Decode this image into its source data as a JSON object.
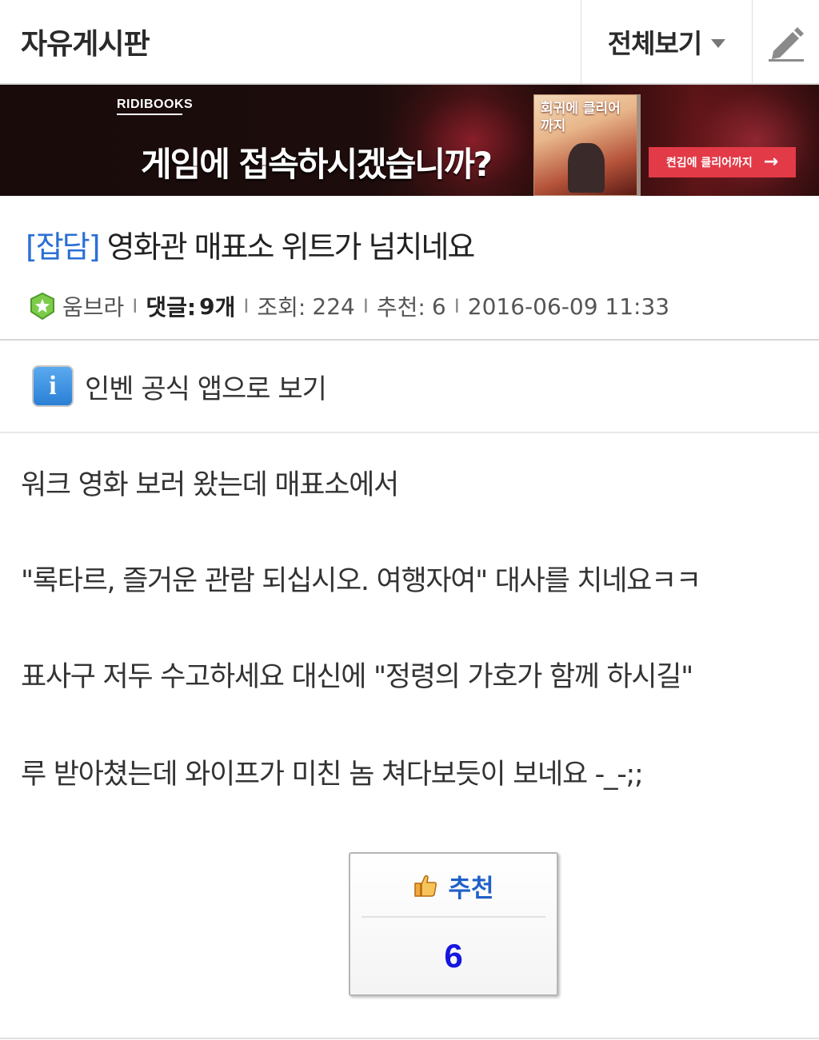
{
  "header": {
    "board_title": "자유게시판",
    "view_all_label": "전체보기"
  },
  "banner": {
    "brand": "RIDIBOOKS",
    "headline": "게임에 접속하시겠습니까?",
    "book_title": "회귀에 클리어 까지",
    "cta_label": "켠김에 클리어까지",
    "cta_arrow": "→"
  },
  "post": {
    "category": "[잡담]",
    "title": "영화관 매표소 위트가 넘치네요",
    "author": "움브라",
    "comments_label": "댓글:",
    "comments_count": "9",
    "comments_unit": "개",
    "views_label": "조회:",
    "views": "224",
    "recommend_label": "추천:",
    "recommend": "6",
    "datetime": "2016-06-09 11:33",
    "separator": "I"
  },
  "app_link": {
    "icon_letter": "i",
    "label": "인벤 공식 앱으로 보기"
  },
  "body": {
    "lines": [
      "워크 영화 보러 왔는데 매표소에서",
      "\"록타르, 즐거운 관람 되십시오. 여행자여\"  대사를 치네요ㅋㅋ",
      "표사구 저두 수고하세요 대신에 \"정령의 가호가 함께 하시길\"",
      "루 받아쳤는데 와이프가 미친 놈 쳐다보듯이 보네요 -_-;;"
    ]
  },
  "recommend_box": {
    "label": "추천",
    "count": "6"
  },
  "colors": {
    "category_blue": "#2b6fd6",
    "recommend_label": "#2060c8",
    "recommend_count": "#1616e0",
    "cta_red": "#e23a47"
  },
  "icons": {
    "level": "level-badge-icon",
    "write": "pencil-icon",
    "dropdown": "caret-down-icon",
    "app": "inven-app-icon",
    "thumbs_up": "thumbs-up-icon"
  }
}
